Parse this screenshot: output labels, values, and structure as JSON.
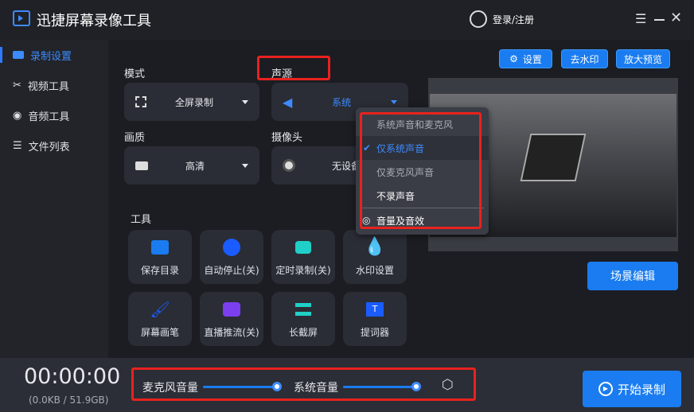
{
  "app": {
    "title": "迅捷屏幕录像工具",
    "login": "登录/注册"
  },
  "sidebar": {
    "items": [
      {
        "label": "录制设置",
        "icon": "camera-icon"
      },
      {
        "label": "视频工具",
        "icon": "video-tools-icon"
      },
      {
        "label": "音频工具",
        "icon": "audio-icon"
      },
      {
        "label": "文件列表",
        "icon": "list-icon"
      }
    ]
  },
  "settings": {
    "mode_label": "模式",
    "mode_value": "全屏录制",
    "audio_label": "声源",
    "audio_value": "系统",
    "quality_label": "画质",
    "quality_value": "高清",
    "camera_label": "摄像头",
    "camera_value": "无设备"
  },
  "audio_menu": {
    "items": [
      "系统声音和麦克风",
      "仅系统声音",
      "仅麦克风声音",
      "不录声音"
    ],
    "selected": "仅系统声音",
    "footer": "音量及音效"
  },
  "tools": {
    "label": "工具",
    "items": [
      "保存目录",
      "自动停止(关)",
      "定时录制(关)",
      "水印设置",
      "屏幕画笔",
      "直播推流(关)",
      "长截屏",
      "提词器"
    ]
  },
  "right": {
    "settings": "设置",
    "remove_watermark": "去水印",
    "preview": "放大预览",
    "scene_edit": "场景编辑"
  },
  "bottom": {
    "timer": "00:00:00",
    "size": "(0.0KB / 51.9GB)",
    "mic_label": "麦克风音量",
    "mic_volume": 100,
    "sys_label": "系统音量",
    "sys_volume": 100,
    "start": "开始录制"
  },
  "colors": {
    "accent": "#1a7cf0",
    "highlight": "#e8221f"
  }
}
